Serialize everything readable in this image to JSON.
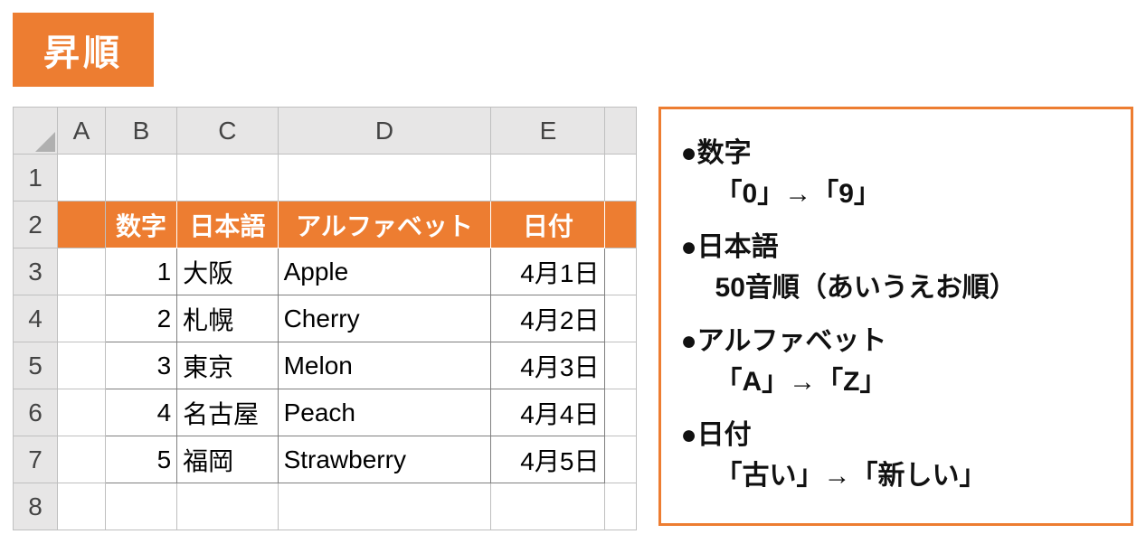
{
  "title": "昇順",
  "columns": [
    "A",
    "B",
    "C",
    "D",
    "E"
  ],
  "row_numbers": [
    "1",
    "2",
    "3",
    "4",
    "5",
    "6",
    "7",
    "8"
  ],
  "table": {
    "headers": [
      "数字",
      "日本語",
      "アルファベット",
      "日付"
    ],
    "rows": [
      {
        "num": "1",
        "jp": "大阪",
        "alpha": "Apple",
        "date": "4月1日"
      },
      {
        "num": "2",
        "jp": "札幌",
        "alpha": "Cherry",
        "date": "4月2日"
      },
      {
        "num": "3",
        "jp": "東京",
        "alpha": "Melon",
        "date": "4月3日"
      },
      {
        "num": "4",
        "jp": "名古屋",
        "alpha": "Peach",
        "date": "4月4日"
      },
      {
        "num": "5",
        "jp": "福岡",
        "alpha": "Strawberry",
        "date": "4月5日"
      }
    ]
  },
  "rules": {
    "r1_title": "●数字",
    "r1_body": "「0」→「9」",
    "r2_title": "●日本語",
    "r2_body": "50音順（あいうえお順）",
    "r3_title": "●アルファベット",
    "r3_body": "「A」→「Z」",
    "r4_title": "●日付",
    "r4_body": "「古い」→「新しい」"
  }
}
